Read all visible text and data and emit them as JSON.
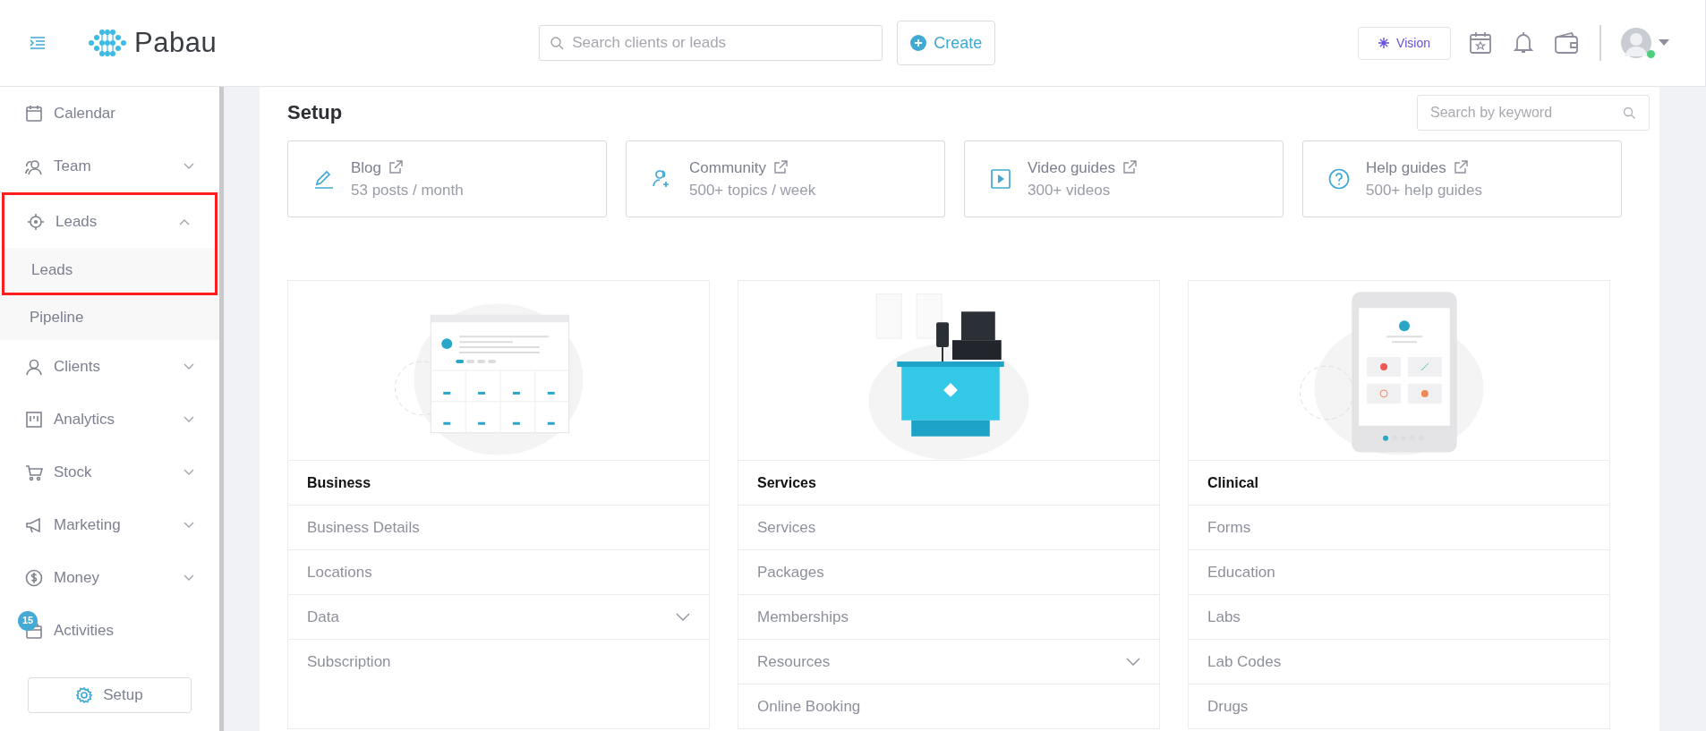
{
  "header": {
    "logo_text": "Pabau",
    "search": {
      "placeholder": "Search clients or leads"
    },
    "create_button": "Create",
    "vision_button": "Vision",
    "user": {
      "online": true
    }
  },
  "sidebar": {
    "items": [
      {
        "label": "Calendar",
        "kind": "link",
        "highlighted": false
      },
      {
        "label": "Team",
        "kind": "group",
        "expanded": false,
        "highlighted": false
      },
      {
        "label": "Leads",
        "kind": "group",
        "expanded": true,
        "highlighted": true,
        "children": [
          {
            "label": "Leads"
          },
          {
            "label": "Pipeline"
          }
        ]
      },
      {
        "label": "Clients",
        "kind": "group",
        "expanded": false,
        "highlighted": false
      },
      {
        "label": "Analytics",
        "kind": "group",
        "expanded": false,
        "highlighted": false
      },
      {
        "label": "Stock",
        "kind": "group",
        "expanded": false,
        "highlighted": false
      },
      {
        "label": "Marketing",
        "kind": "group",
        "expanded": false,
        "highlighted": false
      },
      {
        "label": "Money",
        "kind": "group",
        "expanded": false,
        "highlighted": false
      },
      {
        "label": "Activities",
        "kind": "link",
        "highlighted": false,
        "badge": "15"
      }
    ],
    "setup_button": "Setup"
  },
  "main": {
    "title": "Setup",
    "search": {
      "placeholder": "Search by keyword"
    },
    "resources": [
      {
        "title": "Blog",
        "subtitle": "53 posts / month"
      },
      {
        "title": "Community",
        "subtitle": "500+ topics / week"
      },
      {
        "title": "Video guides",
        "subtitle": "300+ videos"
      },
      {
        "title": "Help guides",
        "subtitle": "500+ help guides"
      }
    ],
    "sections": [
      {
        "title": "Business",
        "items": [
          {
            "label": "Business Details",
            "kind": "link"
          },
          {
            "label": "Locations",
            "kind": "link"
          },
          {
            "label": "Data",
            "kind": "dropdown"
          },
          {
            "label": "Subscription",
            "kind": "link"
          }
        ]
      },
      {
        "title": "Services",
        "items": [
          {
            "label": "Services",
            "kind": "link"
          },
          {
            "label": "Packages",
            "kind": "link"
          },
          {
            "label": "Memberships",
            "kind": "link"
          },
          {
            "label": "Resources",
            "kind": "dropdown"
          },
          {
            "label": "Online Booking",
            "kind": "link"
          }
        ]
      },
      {
        "title": "Clinical",
        "items": [
          {
            "label": "Forms",
            "kind": "link"
          },
          {
            "label": "Education",
            "kind": "link"
          },
          {
            "label": "Labs",
            "kind": "link"
          },
          {
            "label": "Lab Codes",
            "kind": "link"
          },
          {
            "label": "Drugs",
            "kind": "link"
          }
        ]
      }
    ]
  }
}
